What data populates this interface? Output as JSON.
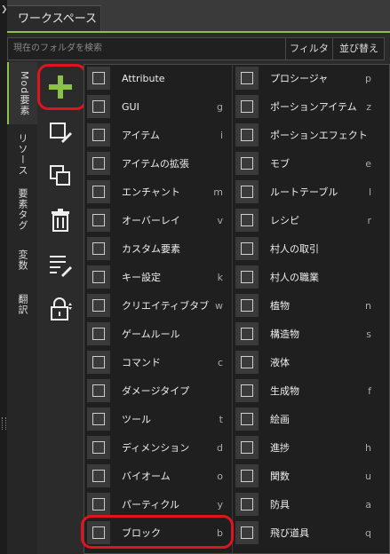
{
  "window": {
    "tab_title": "ワークスペース"
  },
  "search": {
    "placeholder": "現在のフォルダを検索",
    "filter_label": "フィルタ",
    "sort_label": "並び替え"
  },
  "vertical_tabs": [
    {
      "label": "Mod要素",
      "active": true
    },
    {
      "label": "リソース",
      "active": false
    },
    {
      "label": "要素タグ",
      "active": false
    },
    {
      "label": "変数",
      "active": false
    },
    {
      "label": "翻訳",
      "active": false
    }
  ],
  "tools": [
    {
      "icon": "add-icon"
    },
    {
      "icon": "edit-element-icon"
    },
    {
      "icon": "duplicate-icon"
    },
    {
      "icon": "delete-icon"
    },
    {
      "icon": "edit-list-icon"
    },
    {
      "icon": "lock-icon"
    }
  ],
  "menu": {
    "left": [
      {
        "label": "Attribute",
        "shortcut": "",
        "icon": "attribute-icon"
      },
      {
        "label": "GUI",
        "shortcut": "g",
        "icon": "gui-icon"
      },
      {
        "label": "アイテム",
        "shortcut": "i",
        "icon": "gem-icon"
      },
      {
        "label": "アイテムの拡張",
        "shortcut": "",
        "icon": "item-extension-icon"
      },
      {
        "label": "エンチャント",
        "shortcut": "m",
        "icon": "enchant-icon"
      },
      {
        "label": "オーバーレイ",
        "shortcut": "v",
        "icon": "overlay-icon"
      },
      {
        "label": "カスタム要素",
        "shortcut": "",
        "icon": "custom-element-icon"
      },
      {
        "label": "キー設定",
        "shortcut": "k",
        "icon": "keybind-icon"
      },
      {
        "label": "クリエイティブタブ",
        "shortcut": "w",
        "icon": "creative-tab-icon"
      },
      {
        "label": "ゲームルール",
        "shortcut": "",
        "icon": "gamerule-icon"
      },
      {
        "label": "コマンド",
        "shortcut": "c",
        "icon": "command-icon"
      },
      {
        "label": "ダメージタイプ",
        "shortcut": "",
        "icon": "damage-type-icon"
      },
      {
        "label": "ツール",
        "shortcut": "t",
        "icon": "pickaxe-icon"
      },
      {
        "label": "ディメンション",
        "shortcut": "d",
        "icon": "dimension-icon"
      },
      {
        "label": "バイオーム",
        "shortcut": "o",
        "icon": "tree-icon"
      },
      {
        "label": "パーティクル",
        "shortcut": "y",
        "icon": "particle-icon"
      },
      {
        "label": "ブロック",
        "shortcut": "b",
        "icon": "cube-icon"
      }
    ],
    "right": [
      {
        "label": "プロシージャ",
        "shortcut": "p",
        "icon": "folder-icon"
      },
      {
        "label": "ポーションアイテム",
        "shortcut": "z",
        "icon": "flask-icon"
      },
      {
        "label": "ポーションエフェクト",
        "shortcut": "",
        "icon": "swirl-icon"
      },
      {
        "label": "モブ",
        "shortcut": "e",
        "icon": "mob-icon"
      },
      {
        "label": "ルートテーブル",
        "shortcut": "l",
        "icon": "chest-icon"
      },
      {
        "label": "レシピ",
        "shortcut": "r",
        "icon": "crafting-table-icon"
      },
      {
        "label": "村人の取引",
        "shortcut": "",
        "icon": "emerald-icon"
      },
      {
        "label": "村人の職業",
        "shortcut": "",
        "icon": "villager-icon"
      },
      {
        "label": "植物",
        "shortcut": "n",
        "icon": "plant-icon"
      },
      {
        "label": "構造物",
        "shortcut": "s",
        "icon": "structure-icon"
      },
      {
        "label": "液体",
        "shortcut": "",
        "icon": "bucket-icon"
      },
      {
        "label": "生成物",
        "shortcut": "f",
        "icon": "ore-icon"
      },
      {
        "label": "絵画",
        "shortcut": "",
        "icon": "painting-icon"
      },
      {
        "label": "進捗",
        "shortcut": "h",
        "icon": "advancement-icon"
      },
      {
        "label": "関数",
        "shortcut": "u",
        "icon": "function-icon"
      },
      {
        "label": "防具",
        "shortcut": "a",
        "icon": "armor-icon"
      },
      {
        "label": "飛び道具",
        "shortcut": "q",
        "icon": "projectile-icon"
      }
    ]
  },
  "colors": {
    "accent": "#8bc34a",
    "highlight": "#e0141e"
  }
}
